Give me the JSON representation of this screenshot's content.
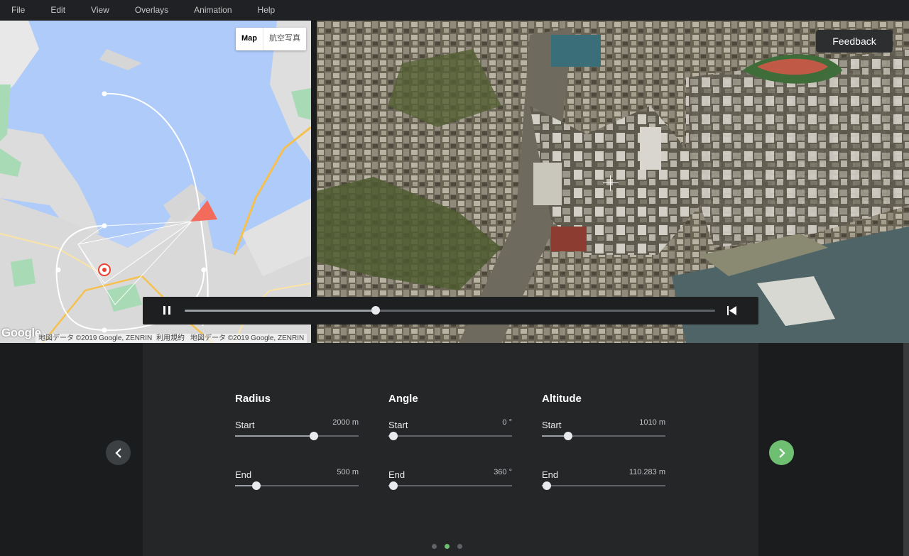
{
  "menu": [
    "File",
    "Edit",
    "View",
    "Overlays",
    "Animation",
    "Help"
  ],
  "map": {
    "type_active": "Map",
    "type_inactive": "航空写真",
    "logo": "Google",
    "attribution_1": "地図データ ©2019 Google, ZENRIN",
    "attribution_2": "利用規約",
    "attribution_3": "地図データ ©2019 Google, ZENRIN"
  },
  "feedback_label": "Feedback",
  "playback": {
    "progress": 0.36
  },
  "panel": {
    "groups": [
      {
        "title": "Radius",
        "start_label": "Start",
        "start_value": "2000 m",
        "start_pos": 0.64,
        "end_label": "End",
        "end_value": "500 m",
        "end_pos": 0.17
      },
      {
        "title": "Angle",
        "start_label": "Start",
        "start_value": "0 °",
        "start_pos": 0.04,
        "end_label": "End",
        "end_value": "360 °",
        "end_pos": 0.04
      },
      {
        "title": "Altitude",
        "start_label": "Start",
        "start_value": "1010 m",
        "start_pos": 0.21,
        "end_label": "End",
        "end_value": "110.283 m",
        "end_pos": 0.04
      }
    ],
    "page_count": 3,
    "active_page": 1
  },
  "colors": {
    "accent": "#6fbf73",
    "water": "#aecbfa",
    "camera": "#f26b5b"
  }
}
